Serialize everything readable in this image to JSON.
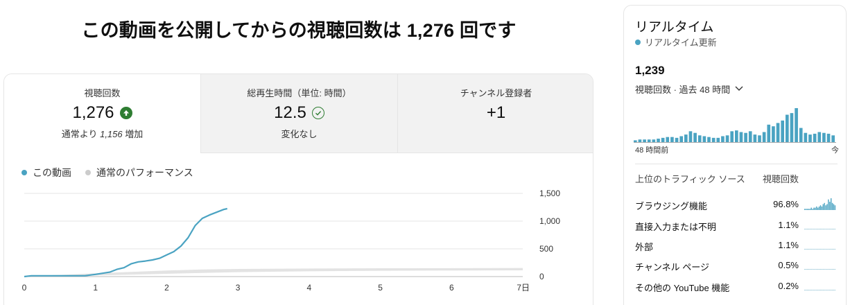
{
  "headline": "この動画を公開してからの視聴回数は 1,276 回です",
  "metrics": [
    {
      "label": "視聴回数",
      "value": "1,276",
      "sub_prefix": "通常より ",
      "sub_number": "1,156",
      "sub_suffix": " 増加"
    },
    {
      "label": "総再生時間（単位: 時間）",
      "value": "12.5",
      "sub": "変化なし"
    },
    {
      "label": "チャンネル登録者",
      "value": "+1"
    }
  ],
  "legend": {
    "this_video": "この動画",
    "typical": "通常のパフォーマンス"
  },
  "colors": {
    "series": "#4aa3c2",
    "typical": "#cccccc",
    "positive": "#2e7d32",
    "bar": "#4aa3c2"
  },
  "chart_data": {
    "type": "line",
    "xlabel": "",
    "ylabel": "",
    "x_ticks": [
      "0",
      "1",
      "2",
      "3",
      "4",
      "5",
      "6",
      "7日"
    ],
    "y_ticks": [
      "0",
      "500",
      "1,000",
      "1,500"
    ],
    "xlim": [
      0,
      7
    ],
    "ylim": [
      0,
      1500
    ],
    "series": [
      {
        "name": "この動画",
        "x": [
          0,
          0.1,
          0.3,
          0.6,
          0.85,
          1.0,
          1.2,
          1.3,
          1.4,
          1.5,
          1.6,
          1.7,
          1.8,
          1.9,
          2.0,
          2.1,
          2.2,
          2.3,
          2.4,
          2.5,
          2.6,
          2.7,
          2.8,
          2.85
        ],
        "y": [
          0,
          15,
          15,
          15,
          15,
          40,
          80,
          130,
          160,
          230,
          265,
          280,
          300,
          330,
          390,
          450,
          550,
          700,
          920,
          1050,
          1110,
          1160,
          1210,
          1225
        ]
      },
      {
        "name": "通常のパフォーマンス",
        "x": [
          0,
          0.5,
          1.0,
          1.5,
          2.0,
          2.5,
          3.0,
          4.0,
          5.0,
          6.0,
          7.0
        ],
        "band_low": [
          0,
          5,
          20,
          35,
          50,
          65,
          80,
          95,
          105,
          110,
          112
        ],
        "band_high": [
          10,
          30,
          60,
          85,
          110,
          128,
          138,
          145,
          150,
          152,
          155
        ]
      }
    ],
    "grid": true,
    "legend_position": "top-left"
  },
  "realtime": {
    "title": "リアルタイム",
    "live_label": "リアルタイム更新",
    "count": "1,239",
    "period": "視聴回数 · 過去 48 時間",
    "axis_start": "48 時間前",
    "axis_end": "今",
    "hourly_bars": [
      3,
      4,
      4,
      4,
      4,
      5,
      6,
      7,
      7,
      6,
      8,
      10,
      14,
      12,
      9,
      8,
      7,
      6,
      6,
      8,
      9,
      14,
      15,
      13,
      12,
      14,
      10,
      9,
      13,
      22,
      20,
      24,
      27,
      34,
      36,
      42,
      18,
      12,
      10,
      11,
      13,
      12,
      11,
      9
    ]
  },
  "traffic": {
    "header_source": "上位のトラフィック ソース",
    "header_views": "視聴回数",
    "rows": [
      {
        "name": "ブラウジング機能",
        "pct": "96.8%"
      },
      {
        "name": "直接入力または不明",
        "pct": "1.1%"
      },
      {
        "name": "外部",
        "pct": "1.1%"
      },
      {
        "name": "チャンネル ページ",
        "pct": "0.5%"
      },
      {
        "name": "その他の YouTube 機能",
        "pct": "0.2%"
      }
    ]
  }
}
